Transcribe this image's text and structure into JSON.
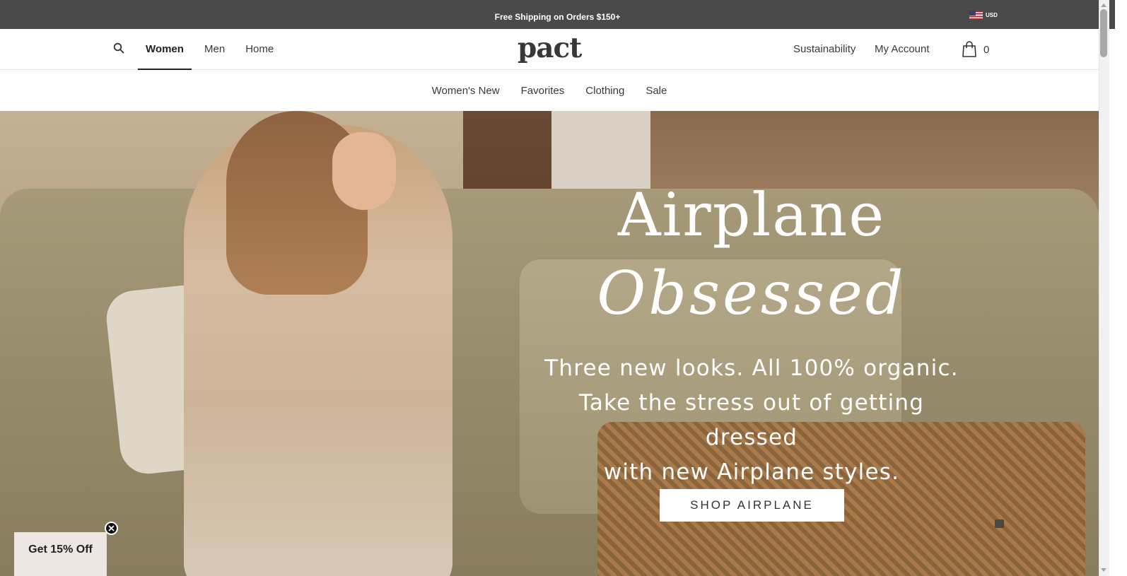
{
  "announcement": {
    "text": "Free Shipping on Orders $150+",
    "currency": "USD",
    "currency_flag": "us-flag-icon"
  },
  "header": {
    "search_icon": "search-icon",
    "nav": [
      "Women",
      "Men",
      "Home"
    ],
    "active_nav": "Women",
    "logo": "pact",
    "links": [
      "Sustainability",
      "My Account"
    ],
    "cart_icon": "shopping-bag-icon",
    "cart_count": "0"
  },
  "subnav": [
    "Women's New",
    "Favorites",
    "Clothing",
    "Sale"
  ],
  "hero": {
    "headline_line1": "Airplane",
    "headline_line2": "Obsessed",
    "subcopy_line1": "Three new looks. All 100% organic.",
    "subcopy_line2": "Take the stress out of getting dressed",
    "subcopy_line3": "with new Airplane styles.",
    "cta": "SHOP AIRPLANE"
  },
  "promo": {
    "label": "Get 15% Off",
    "close_icon": "close-icon"
  },
  "colors": {
    "announcement_bg": "#4a4a4a",
    "promo_bg": "#ece7e3",
    "text_dark": "#222222"
  }
}
